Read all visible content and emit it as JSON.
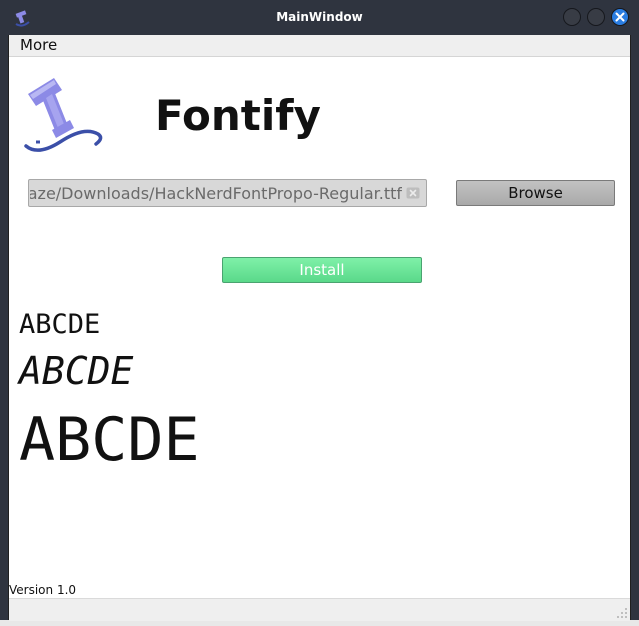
{
  "window": {
    "title": "MainWindow"
  },
  "menubar": {
    "items": [
      {
        "label": "More"
      }
    ]
  },
  "header": {
    "app_name": "Fontify",
    "logo_icon": "fontify-logo-icon"
  },
  "file_picker": {
    "path_value": "/home/blaze/Downloads/HackNerdFontPropo-Regular.ttf",
    "browse_label": "Browse"
  },
  "actions": {
    "install_label": "Install"
  },
  "preview": {
    "regular": "ABCDE",
    "italic": "ABCDE",
    "large": "ABCDE"
  },
  "footer": {
    "version": "Version 1.0"
  },
  "colors": {
    "install_button": "#5ad98a",
    "browse_button": "#b5b5b5",
    "titlebar": "#2f343f",
    "close_button": "#2a7de1",
    "logo_purple": "#8c8ae6",
    "logo_blue": "#3b4fa8"
  }
}
